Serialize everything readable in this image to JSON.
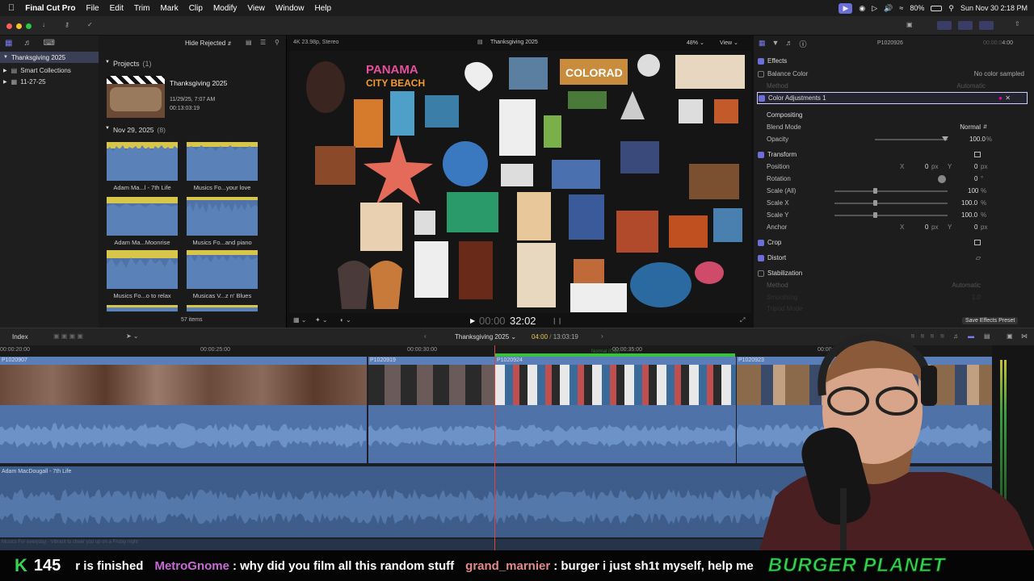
{
  "menubar": {
    "app": "Final Cut Pro",
    "items": [
      "File",
      "Edit",
      "Trim",
      "Mark",
      "Clip",
      "Modify",
      "View",
      "Window",
      "Help"
    ],
    "battery": "80%",
    "datetime": "Sun Nov 30  2:18 PM"
  },
  "sidebar": {
    "library": "Thanksgiving 2025",
    "items": [
      "Smart Collections",
      "11-27-25"
    ]
  },
  "browser": {
    "filter": "Hide Rejected",
    "projects_header": "Projects",
    "projects_count": "(1)",
    "project": {
      "name": "Thanksgiving 2025",
      "date": "11/29/25, 7:07 AM",
      "duration": "00:13:03:19"
    },
    "group_header": "Nov 29, 2025",
    "group_count": "(8)",
    "clips": [
      "Adam Ma...l - 7th Life",
      "Musics Fo...your love",
      "Adam Ma...Moonrise",
      "Musics Fo...and piano",
      "Musics Fo...o to relax",
      "Musicas V...z n' Blues"
    ],
    "items_count": "57 items"
  },
  "viewer": {
    "format": "4K 23.98p, Stereo",
    "title": "Thanksgiving 2025",
    "zoom": "48%",
    "view": "View",
    "timecode_dim": "00:00",
    "timecode": "32:02"
  },
  "inspector": {
    "clip": "P1020926",
    "duration_dim": "00:00:0",
    "duration": "4:00",
    "effects": "Effects",
    "balance": "Balance Color",
    "balance_status": "No color sampled",
    "method": "Method",
    "method_val": "Automatic",
    "color_adj": "Color Adjustments 1",
    "compositing": "Compositing",
    "blend_mode": "Blend Mode",
    "blend_val": "Normal",
    "opacity": "Opacity",
    "opacity_val": "100.0",
    "pct": "%",
    "transform": "Transform",
    "position": "Position",
    "rotation": "Rotation",
    "scale_all": "Scale (All)",
    "scale_x": "Scale X",
    "scale_y": "Scale Y",
    "anchor": "Anchor",
    "x": "X",
    "y": "Y",
    "zero": "0",
    "px": "px",
    "deg": "°",
    "hundred": "100",
    "hundred1": "100.0",
    "crop": "Crop",
    "distort": "Distort",
    "stabilization": "Stabilization",
    "stab_method": "Method",
    "stab_method_val": "Automatic",
    "smoothing": "Smoothing",
    "smoothing_val": "1.0",
    "tripod": "Tripod Mode",
    "save_preset": "Save Effects Preset"
  },
  "timeline": {
    "index": "Index",
    "project": "Thanksgiving 2025",
    "tc_a": "04:00",
    "tc_sep": "/",
    "tc_b": "13:03:19",
    "ruler": [
      "00:00:20:00",
      "00:00:25:00",
      "00:00:30:00",
      "00:00:35:00",
      "00:00:4"
    ],
    "clips": [
      "P1020907",
      "P1020919",
      "P1020924",
      "P1020923"
    ],
    "audio_title": "Adam MacDougall - 7th Life",
    "bottom_label": "Musics For everyday · Vibrant to cheer you up on a Friday night",
    "marker": "Normal (Clip)"
  },
  "ticker": {
    "count": "145",
    "msg0": "r is finished",
    "user1": "MetroGnome",
    "msg1": ": why did you film all this random stuff",
    "user2": "grand_marnier",
    "msg2": ": burger i just sh1t myself, help me",
    "logo": "BURGER PLANET"
  },
  "colors": {
    "accent": "#6d6fd8",
    "timeline_clip": "#4f73a8",
    "playhead": "#e0413a",
    "ticker_green": "#39d353",
    "ticker_user": "#c86bd6"
  }
}
